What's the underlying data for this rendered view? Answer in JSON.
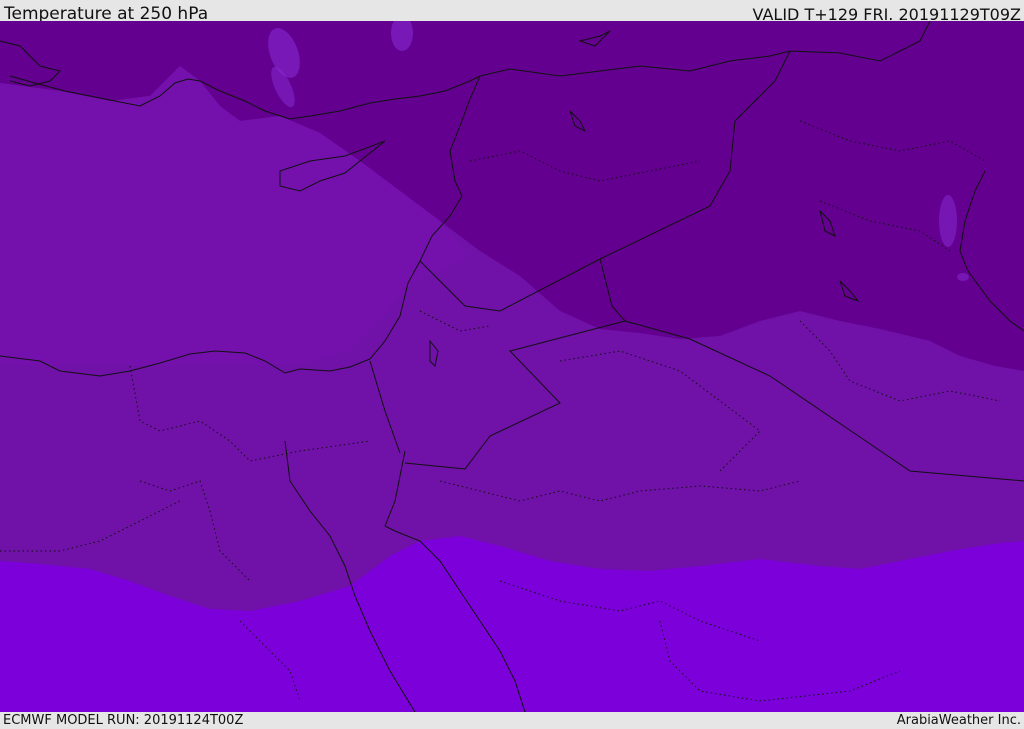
{
  "header": {
    "title": "Temperature at 250 hPa",
    "valid": "VALID T+129 FRI. 20191129T09Z"
  },
  "footer": {
    "model_run": "ECMWF MODEL RUN: 20191124T00Z",
    "credit": "ArabiaWeather Inc."
  },
  "map": {
    "colors": {
      "coldest": "#63008f",
      "cold": "#7411ad",
      "mid": "#7011a8",
      "warm": "#7c00da",
      "pale": "#8a2bd8",
      "border": "#111111"
    }
  }
}
